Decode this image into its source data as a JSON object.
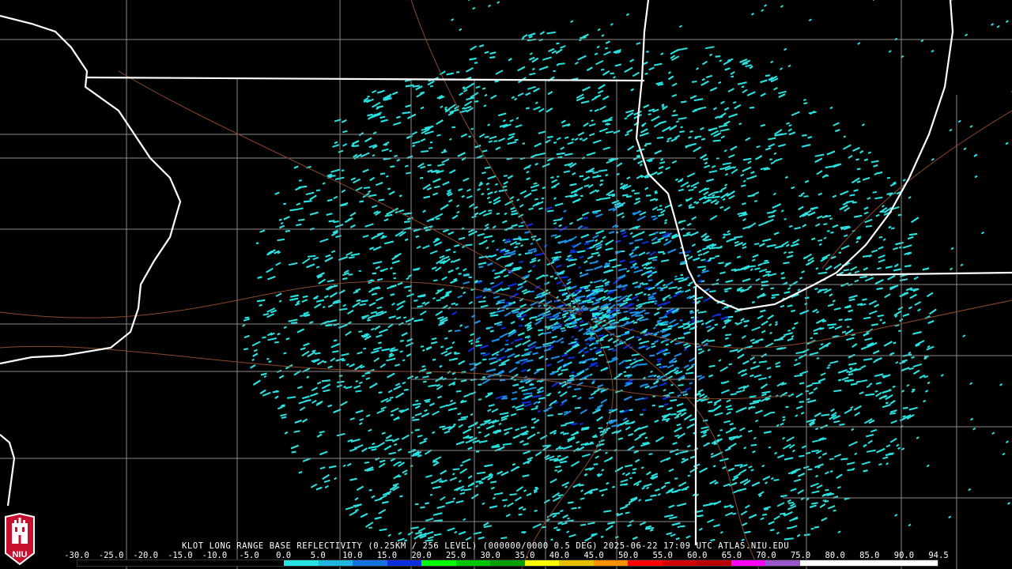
{
  "product": {
    "caption": "KLOT LONG RANGE BASE REFLECTIVITY (0.25KM / 256 LEVEL) (000000/0000 0.5 DEG) 2025-06-22 17:09 UTC  ATLAS.NIU.EDU"
  },
  "scale": {
    "ticks": [
      "-30.0",
      "-25.0",
      "-20.0",
      "-15.0",
      "-10.0",
      "-5.0",
      "0.0",
      "5.0",
      "10.0",
      "15.0",
      "20.0",
      "25.0",
      "30.0",
      "35.0",
      "40.0",
      "45.0",
      "50.0",
      "55.0",
      "60.0",
      "65.0",
      "70.0",
      "75.0",
      "80.0",
      "85.0",
      "90.0",
      "94.5"
    ],
    "colors": [
      "#000000",
      "#000000",
      "#000000",
      "#000000",
      "#000000",
      "#000000",
      "#29e3e3",
      "#1fb5e0",
      "#1471e0",
      "#0a2ee0",
      "#00ff00",
      "#00c800",
      "#00a000",
      "#ffff00",
      "#e6c000",
      "#ff9000",
      "#ff0000",
      "#d40000",
      "#b80000",
      "#ff00ff",
      "#9955c9",
      "#ffffff",
      "#ffffff",
      "#ffffff",
      "#ffffff"
    ]
  },
  "logo": {
    "text": "NIU"
  },
  "map": {
    "radar_site": "KLOT",
    "colors": {
      "state_lines": "#ffffff",
      "county_lines": "#8a8a8a",
      "highways": "#8b4a2b",
      "echo_light": "#29e3e3",
      "echo_medium": "#1a8fe6",
      "echo_dark": "#0a2ee0"
    }
  }
}
